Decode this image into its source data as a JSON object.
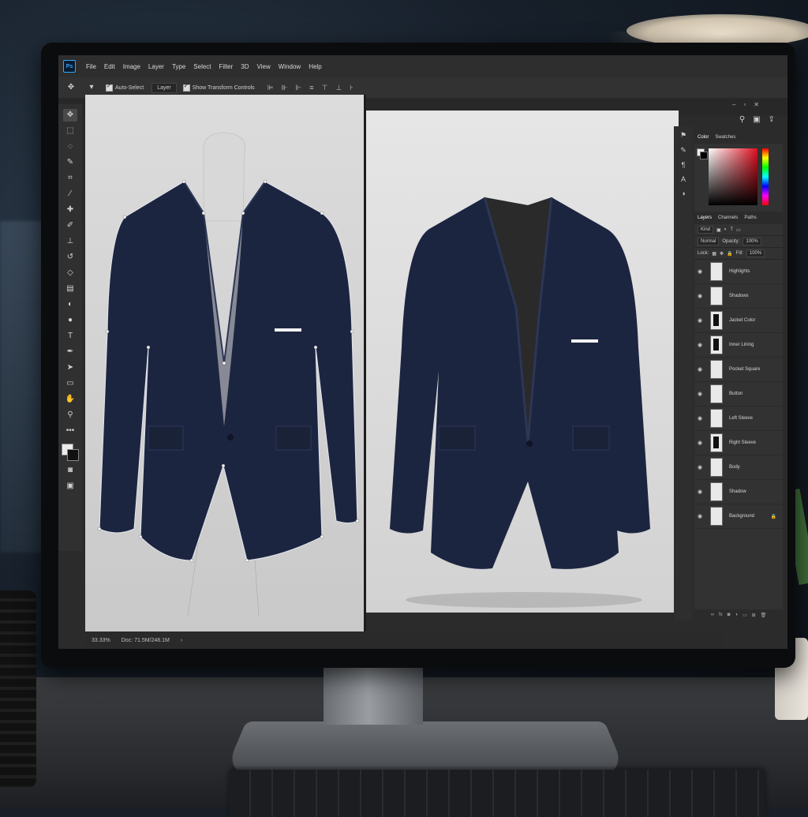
{
  "app": {
    "logo": "Ps"
  },
  "menu": [
    "File",
    "Edit",
    "Image",
    "Layer",
    "Type",
    "Select",
    "Filter",
    "3D",
    "View",
    "Window",
    "Help"
  ],
  "options_bar": {
    "auto_select_label": "Auto-Select",
    "auto_select_target": "Layer",
    "show_transform_label": "Show Transform Controls"
  },
  "toolbar": {
    "tools": [
      "move-icon",
      "marquee-icon",
      "lasso-icon",
      "quick-select-icon",
      "crop-icon",
      "eyedropper-icon",
      "healing-icon",
      "brush-icon",
      "clone-stamp-icon",
      "history-brush-icon",
      "eraser-icon",
      "gradient-icon",
      "blur-icon",
      "dodge-icon",
      "type-icon",
      "pen-icon",
      "path-select-icon",
      "shape-icon",
      "hand-icon",
      "zoom-icon",
      "more-icon"
    ]
  },
  "panels": {
    "color_tabs": [
      "Color",
      "Swatches"
    ],
    "layer_tabs": [
      "Layers",
      "Channels",
      "Paths"
    ],
    "kind_filter": "Kind",
    "blend_mode": "Normal",
    "opacity_label": "Opacity:",
    "opacity_value": "100%",
    "lock_label": "Lock:",
    "fill_label": "Fill:",
    "fill_value": "100%",
    "layers": [
      {
        "name": "Highlights",
        "thumb": "light"
      },
      {
        "name": "Shadows",
        "thumb": "light"
      },
      {
        "name": "Jacket Color",
        "thumb": "dark"
      },
      {
        "name": "Inner Lining",
        "thumb": "dark"
      },
      {
        "name": "Pocket Square",
        "thumb": "light"
      },
      {
        "name": "Button",
        "thumb": "light"
      },
      {
        "name": "Left Sleeve",
        "thumb": "light"
      },
      {
        "name": "Right Sleeve",
        "thumb": "dark"
      },
      {
        "name": "Body",
        "thumb": "light"
      },
      {
        "name": "Shadow",
        "thumb": "light"
      },
      {
        "name": "Background",
        "thumb": "light",
        "locked": true
      }
    ]
  },
  "status": {
    "zoom": "33.33%",
    "doc": "Doc: 71.5M/248.1M"
  },
  "colors": {
    "jacket": "#1c2540",
    "lining": "#2a2a2a",
    "accent": "#31a8ff"
  }
}
